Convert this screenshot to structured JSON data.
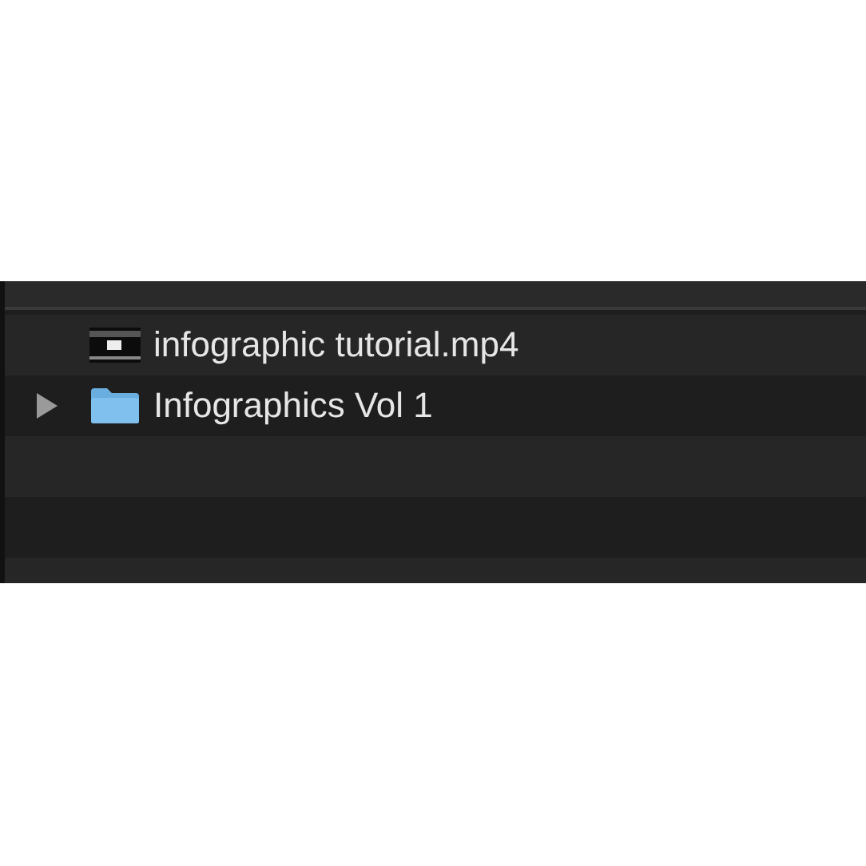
{
  "file_list": {
    "items": [
      {
        "kind": "video",
        "name": "infographic tutorial.mp4"
      },
      {
        "kind": "folder",
        "name": "Infographics Vol 1",
        "expanded": false
      }
    ]
  }
}
